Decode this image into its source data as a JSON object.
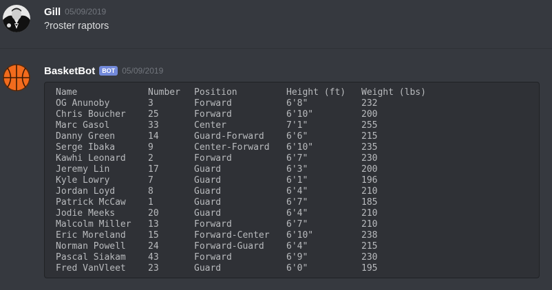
{
  "messages": [
    {
      "author": "Gill",
      "timestamp": "05/09/2019",
      "avatar": "godfather-avatar-icon",
      "text": "?roster raptors"
    },
    {
      "author": "BasketBot",
      "bot_tag": "BOT",
      "timestamp": "05/09/2019",
      "avatar": "basketball-avatar-icon",
      "roster": {
        "headers": [
          "Name",
          "Number",
          "Position",
          "Height (ft)",
          "Weight (lbs)"
        ],
        "rows": [
          [
            "OG Anunoby",
            "3",
            "Forward",
            "6'8\"",
            "232"
          ],
          [
            "Chris Boucher",
            "25",
            "Forward",
            "6'10\"",
            "200"
          ],
          [
            "Marc Gasol",
            "33",
            "Center",
            "7'1\"",
            "255"
          ],
          [
            "Danny Green",
            "14",
            "Guard-Forward",
            "6'6\"",
            "215"
          ],
          [
            "Serge Ibaka",
            "9",
            "Center-Forward",
            "6'10\"",
            "235"
          ],
          [
            "Kawhi Leonard",
            "2",
            "Forward",
            "6'7\"",
            "230"
          ],
          [
            "Jeremy Lin",
            "17",
            "Guard",
            "6'3\"",
            "200"
          ],
          [
            "Kyle Lowry",
            "7",
            "Guard",
            "6'1\"",
            "196"
          ],
          [
            "Jordan Loyd",
            "8",
            "Guard",
            "6'4\"",
            "210"
          ],
          [
            "Patrick McCaw",
            "1",
            "Guard",
            "6'7\"",
            "185"
          ],
          [
            "Jodie Meeks",
            "20",
            "Guard",
            "6'4\"",
            "210"
          ],
          [
            "Malcolm Miller",
            "13",
            "Forward",
            "6'7\"",
            "210"
          ],
          [
            "Eric Moreland",
            "15",
            "Forward-Center",
            "6'10\"",
            "238"
          ],
          [
            "Norman Powell",
            "24",
            "Forward-Guard",
            "6'4\"",
            "215"
          ],
          [
            "Pascal Siakam",
            "43",
            "Forward",
            "6'9\"",
            "230"
          ],
          [
            "Fred VanVleet",
            "23",
            "Guard",
            "6'0\"",
            "195"
          ]
        ]
      }
    }
  ],
  "colors": {
    "background": "#36393f",
    "codeblock": "#2f3136",
    "bot_tag": "#7289da",
    "basketball": "#f26b1d"
  }
}
